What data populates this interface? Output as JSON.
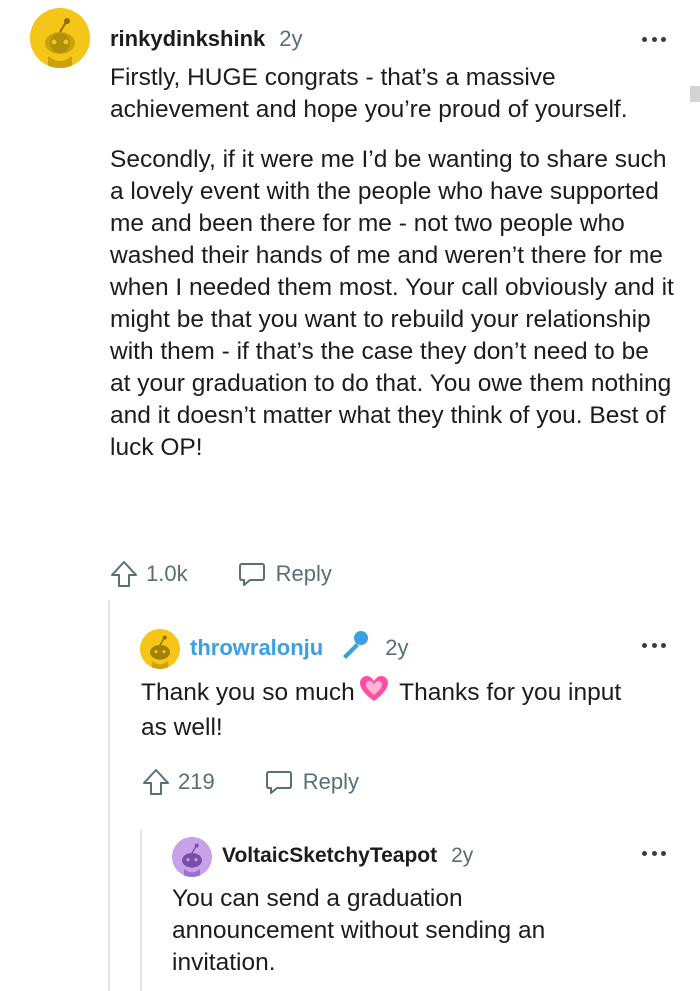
{
  "comments": [
    {
      "username": "rinkydinkshink",
      "age": "2y",
      "paragraphs": [
        "Firstly, HUGE congrats - that’s a massive achievement and hope you’re proud of yourself.",
        "Secondly, if it were me I’d be wanting to share such a lovely event with the people who have supported me and been there for me - not two people who washed their hands of me and weren’t there for me when I needed them most. Your call obviously and it might be that you want to rebuild your relationship with them - if that’s the case they don’t need to be at your graduation to do that. You owe them nothing and it doesn’t matter what they think of you. Best of luck OP!"
      ],
      "votes": "1.0k",
      "reply_label": "Reply",
      "avatar_color": "#f5c518"
    },
    {
      "username": "throwralonju",
      "age": "2y",
      "text_before_emoji": "Thank you so much",
      "text_after_emoji": " Thanks for you input as well!",
      "votes": "219",
      "reply_label": "Reply",
      "avatar_color": "#f5c518",
      "username_color": "#3aa0e0",
      "badge_icon": "microphone-icon",
      "emoji": "sparkling-heart-emoji"
    },
    {
      "username": "VoltaicSketchyTeapot",
      "age": "2y",
      "text": "You can send a graduation announcement without sending an invitation.",
      "avatar_color": "#c7a2e8"
    }
  ]
}
